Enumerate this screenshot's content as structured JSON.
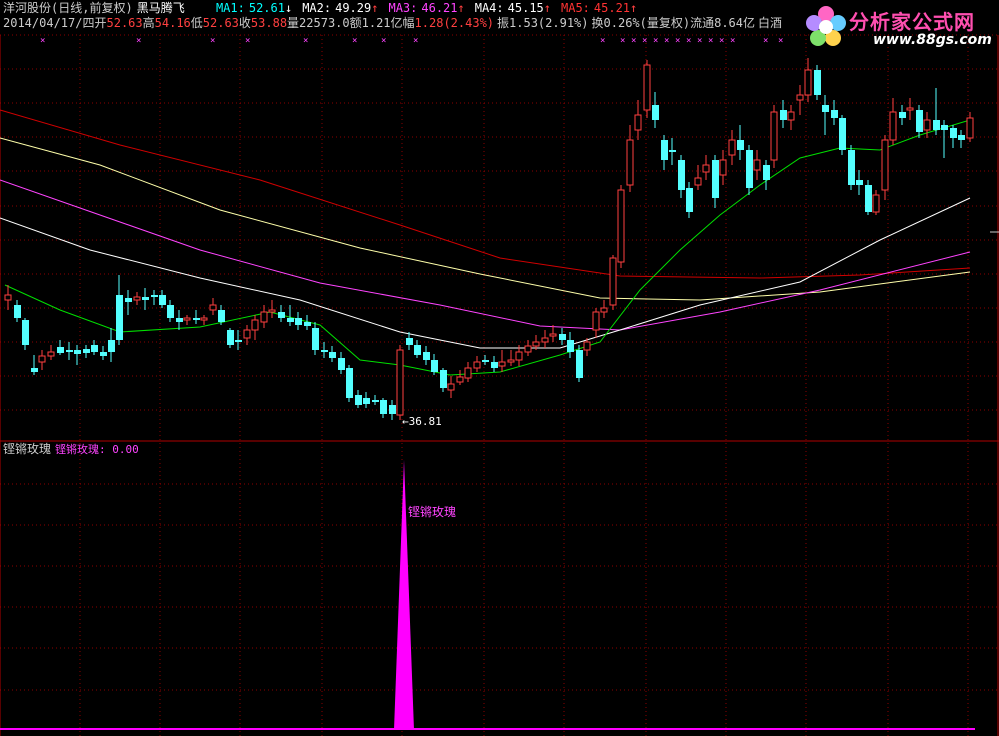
{
  "header": {
    "stock_name": "洋河股份(日线,前复权)",
    "indicator_name": "黑马腾飞",
    "ma": [
      {
        "label": "MA1:",
        "value": "52.61",
        "arrow": "↓",
        "color": "#00ffff"
      },
      {
        "label": "MA2:",
        "value": "49.29",
        "arrow": "↑",
        "color": "#ffffff"
      },
      {
        "label": "MA3:",
        "value": "46.21",
        "arrow": "↑",
        "color": "#ff44ff"
      },
      {
        "label": "MA4:",
        "value": "45.15",
        "arrow": "↑",
        "color": "#ffffff"
      },
      {
        "label": "MA5:",
        "value": "45.21",
        "arrow": "↑",
        "color": "#ff3333"
      }
    ]
  },
  "info": {
    "date": "2014/04/17/四",
    "open_label": "开",
    "open": "52.63",
    "high_label": "高",
    "high": "54.16",
    "low_label": "低",
    "low": "52.63",
    "close_label": "收",
    "close": "53.88",
    "volume": "量22573.0",
    "amount": "额1.21亿",
    "range_label": "幅",
    "range": "1.28(2.43%)",
    "amplitude": "振1.53(2.91%)",
    "turnover": "换0.26%(量复权)",
    "float_cap": "流通8.64亿",
    "sector": "白酒"
  },
  "annotations": {
    "low_marker": "←36.81",
    "signal_label": "铿锵玫瑰"
  },
  "lower_panel": {
    "indicator_name": "铿锵玫瑰",
    "value_text": "铿锵玫瑰: 0.00"
  },
  "logo": {
    "title": "分析家公式网",
    "url": "www.88gs.com",
    "icon": "flower-icon"
  },
  "colors": {
    "up": "#ff4040",
    "down": "#54ffff",
    "grid": "#8b0000",
    "signal": "#ff00ff",
    "ma1": "#00e000",
    "ma2": "#ffffff",
    "ma3": "#ff44ff",
    "ma4": "#ffffaa",
    "ma5": "#d00000"
  }
}
